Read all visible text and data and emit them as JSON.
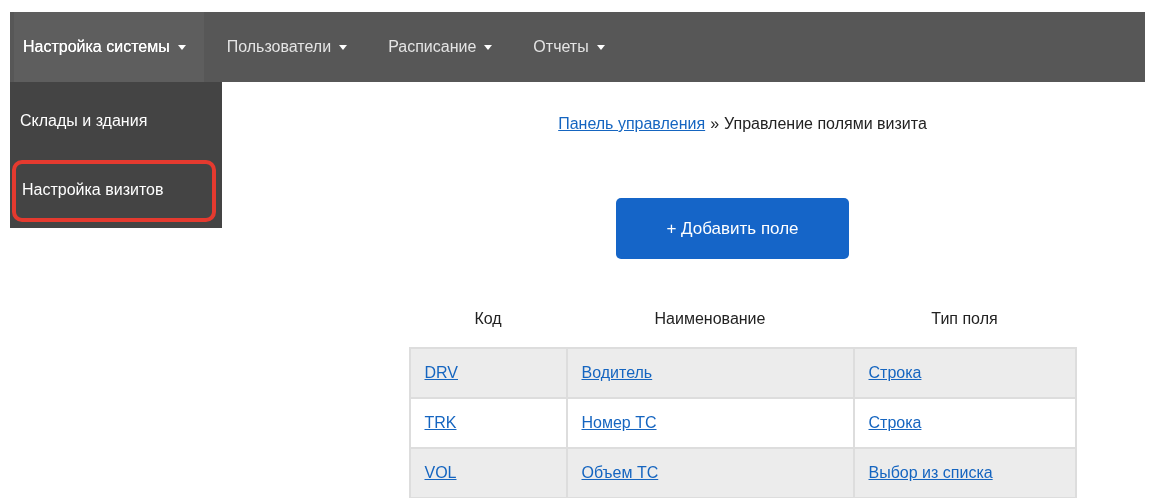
{
  "nav": {
    "items": [
      {
        "label": "Настройка системы",
        "selected": true
      },
      {
        "label": "Пользователи",
        "selected": false
      },
      {
        "label": "Расписание",
        "selected": false
      },
      {
        "label": "Отчеты",
        "selected": false
      }
    ]
  },
  "dropdown": {
    "items": [
      {
        "label": "Склады и здания",
        "selected": false
      },
      {
        "label": "Настройка визитов",
        "selected": true
      }
    ]
  },
  "breadcrumb": {
    "link": "Панель управления",
    "separator": "»",
    "current": "Управление полями визита"
  },
  "add_button": "+ Добавить поле",
  "table": {
    "columns": [
      "Код",
      "Наименование",
      "Тип поля"
    ],
    "rows": [
      [
        "DRV",
        "Водитель",
        "Строка"
      ],
      [
        "TRK",
        "Номер ТС",
        "Строка"
      ],
      [
        "VOL",
        "Объем ТС",
        "Выбор из списка"
      ]
    ]
  }
}
